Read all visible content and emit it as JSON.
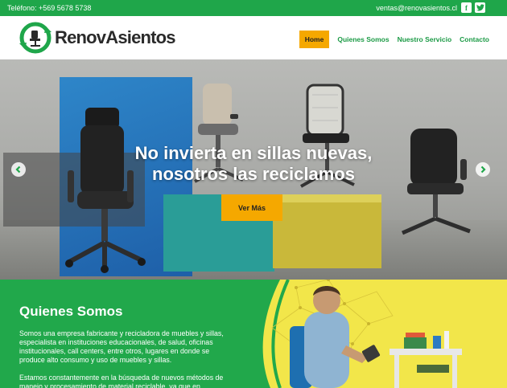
{
  "topbar": {
    "phone": "Teléfono: +569 5678 5738",
    "email": "ventas@renovasientos.cl",
    "facebook_icon": "facebook-icon",
    "twitter_icon": "twitter-icon"
  },
  "header": {
    "logo_text": "RenovAsientos",
    "nav": [
      {
        "label": "Home",
        "active": true
      },
      {
        "label": "Quienes Somos",
        "active": false
      },
      {
        "label": "Nuestro Servicio",
        "active": false
      },
      {
        "label": "Contacto",
        "active": false
      }
    ]
  },
  "hero": {
    "title_line1": "No invierta en sillas nuevas,",
    "title_line2": "nosotros las reciclamos",
    "button_label": "Ver Más",
    "prev_icon": "chevron-left-icon",
    "next_icon": "chevron-right-icon"
  },
  "about": {
    "title": "Quienes Somos",
    "paragraph1": "Somos una empresa fabricante y recicladora de muebles y sillas, especialista en instituciones educacionales, de salud, oficinas institucionales, call centers, entre otros, lugares en donde se produce alto consumo y uso de muebles y sillas.",
    "paragraph2": "Estamos constantemente en la búsqueda de nuevos métodos de manejo y procesamiento de material reciclable, ya que en"
  },
  "colors": {
    "brand_green": "#1fa64a",
    "accent_orange": "#f5a800",
    "nav_green": "#1b9a45"
  }
}
